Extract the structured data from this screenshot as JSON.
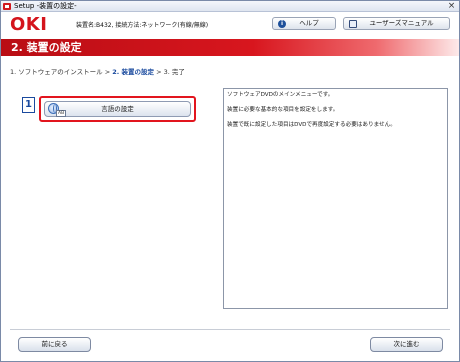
{
  "window": {
    "title": "Setup -装置の設定-",
    "close_label": "×"
  },
  "header": {
    "logo_text": "OKI",
    "device_info": "装置名:B432, 接続方法:ネットワーク(有線/無線)",
    "help_label": "ヘルプ",
    "manual_label": "ユーザーズマニュアル"
  },
  "banner": {
    "title": "2. 装置の設定"
  },
  "steps": {
    "step1": "1. ソフトウェアのインストール",
    "sep1": " > ",
    "step2": "2. 装置の設定",
    "sep2": " > ",
    "step3": "3. 完了"
  },
  "actions": {
    "step_number": "1",
    "language_button_label": "言語の設定",
    "language_icon_text": "AB"
  },
  "description": {
    "line1": "ソフトウェアDVDのメインメニューです。",
    "line2": "装置に必要な基本的な項目を設定をします。",
    "line3": "装置で既に設定した項目はDVDで再度設定する必要はありません。"
  },
  "footer": {
    "back_label": "前に戻る",
    "next_label": "次に進む"
  },
  "colors": {
    "brand_red": "#d4141c",
    "accent_blue": "#1a4a9e"
  }
}
